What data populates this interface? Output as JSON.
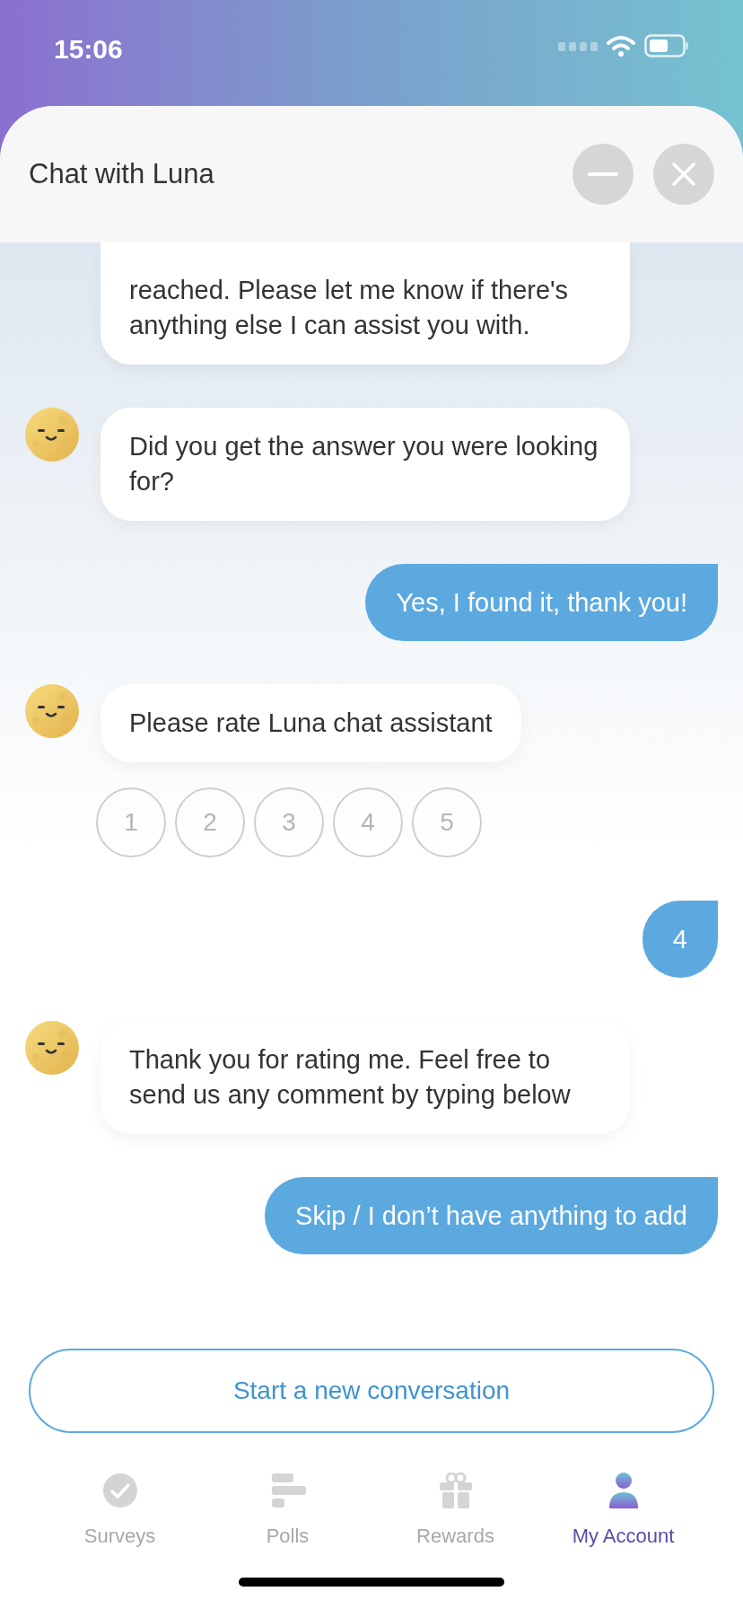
{
  "status_bar": {
    "time": "15:06"
  },
  "header": {
    "title": "Chat with Luna"
  },
  "messages": [
    {
      "kind": "bot",
      "text": "reached. Please let me know if there's anything else I can assist you with."
    },
    {
      "kind": "bot",
      "text": "Did you get the answer you were looking for?"
    },
    {
      "kind": "user",
      "text": "Yes, I found it, thank you!"
    },
    {
      "kind": "bot",
      "text": "Please rate Luna chat assistant"
    },
    {
      "kind": "rating",
      "options": [
        {
          "label": "1",
          "selected": false
        },
        {
          "label": "2",
          "selected": false
        },
        {
          "label": "3",
          "selected": false
        },
        {
          "label": "4",
          "selected": false
        },
        {
          "label": "5",
          "selected": false
        }
      ]
    },
    {
      "kind": "user",
      "text": "4"
    },
    {
      "kind": "bot",
      "text": "Thank you for rating me. Feel free to send us any comment by typing below"
    },
    {
      "kind": "user",
      "text": "Skip / I don’t have anything to add"
    }
  ],
  "new_conversation_button": "Start a new conversation",
  "tab_bar": [
    {
      "label": "Surveys",
      "selected": false
    },
    {
      "label": "Polls",
      "selected": false
    },
    {
      "label": "Rewards",
      "selected": false
    },
    {
      "label": "My Account",
      "selected": true
    }
  ]
}
